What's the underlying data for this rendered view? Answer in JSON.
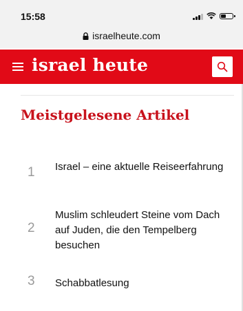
{
  "status_bar": {
    "time": "15:58"
  },
  "url_bar": {
    "domain": "israelheute.com"
  },
  "header": {
    "brand": "israel heute",
    "accent_color": "#e10a17"
  },
  "section": {
    "title": "Meistgelesene Artikel"
  },
  "articles": [
    {
      "number": "1",
      "title": "Israel – eine aktuelle Reiseerfahrung"
    },
    {
      "number": "2",
      "title": "Muslim schleudert Steine vom Dach auf Juden, die den Tempelberg besuchen"
    },
    {
      "number": "3",
      "title": "Schabbatlesung"
    }
  ],
  "icons": [
    "signal-icon",
    "wifi-icon",
    "battery-icon",
    "lock-icon",
    "menu-icon",
    "search-icon"
  ]
}
